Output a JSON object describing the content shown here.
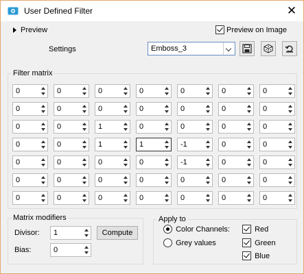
{
  "window": {
    "title": "User Defined Filter",
    "close_glyph": "✕"
  },
  "preview": {
    "label": "Preview",
    "preview_on_image_label": "Preview on Image",
    "preview_on_image_checked": true
  },
  "settings": {
    "label": "Settings",
    "selected": "Emboss_3",
    "buttons": [
      "save-icon",
      "dice-icon",
      "reset-icon"
    ]
  },
  "filter_matrix": {
    "label": "Filter matrix",
    "rows": [
      [
        "0",
        "0",
        "0",
        "0",
        "0",
        "0",
        "0"
      ],
      [
        "0",
        "0",
        "0",
        "0",
        "0",
        "0",
        "0"
      ],
      [
        "0",
        "0",
        "1",
        "0",
        "0",
        "0",
        "0"
      ],
      [
        "0",
        "0",
        "1",
        "1",
        "-1",
        "0",
        "0"
      ],
      [
        "0",
        "0",
        "0",
        "0",
        "-1",
        "0",
        "0"
      ],
      [
        "0",
        "0",
        "0",
        "0",
        "0",
        "0",
        "0"
      ],
      [
        "0",
        "0",
        "0",
        "0",
        "0",
        "0",
        "0"
      ]
    ]
  },
  "modifiers": {
    "label": "Matrix modifiers",
    "divisor_label": "Divisor:",
    "divisor": "1",
    "bias_label": "Bias:",
    "bias": "0",
    "compute_label": "Compute"
  },
  "apply_to": {
    "label": "Apply to",
    "color_channels_label": "Color Channels:",
    "grey_values_label": "Grey values",
    "color_channels_selected": true,
    "red_label": "Red",
    "green_label": "Green",
    "blue_label": "Blue"
  }
}
